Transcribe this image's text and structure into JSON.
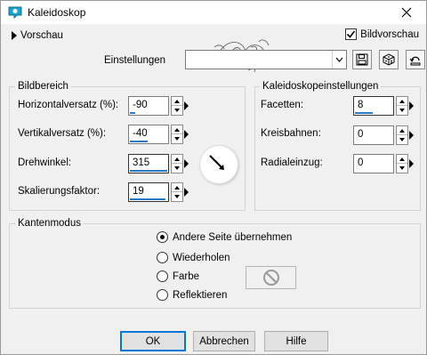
{
  "window": {
    "title": "Kaleidoskop",
    "close_icon": "close-icon",
    "app_icon": "kaleidoscope-icon"
  },
  "top": {
    "preview_label": "Vorschau",
    "preview_check_label": "Bildvorschau",
    "preview_checked": true
  },
  "settings": {
    "label": "Einstellungen",
    "value": ""
  },
  "bildbereich": {
    "title": "Bildbereich",
    "fields": [
      {
        "label": "Horizontalversatz (%):",
        "value": "-90"
      },
      {
        "label": "Vertikalversatz (%):",
        "value": "-40"
      },
      {
        "label": "Drehwinkel:",
        "value": "315"
      },
      {
        "label": "Skalierungsfaktor:",
        "value": "19"
      }
    ]
  },
  "kaleido": {
    "title": "Kaleidoskopeinstellungen",
    "fields": [
      {
        "label": "Facetten:",
        "value": "8"
      },
      {
        "label": "Kreisbahnen:",
        "value": "0"
      },
      {
        "label": "Radialeinzug:",
        "value": "0"
      }
    ]
  },
  "kantenmodus": {
    "title": "Kantenmodus",
    "options": [
      {
        "label": "Andere Seite übernehmen",
        "selected": true
      },
      {
        "label": "Wiederholen",
        "selected": false
      },
      {
        "label": "Farbe",
        "selected": false
      },
      {
        "label": "Reflektieren",
        "selected": false
      }
    ]
  },
  "buttons": {
    "ok": "OK",
    "cancel": "Abbrechen",
    "help": "Hilfe"
  },
  "colors": {
    "accent": "#2b79c2",
    "background": "#f0f0f0",
    "default_border": "#0078d7"
  }
}
